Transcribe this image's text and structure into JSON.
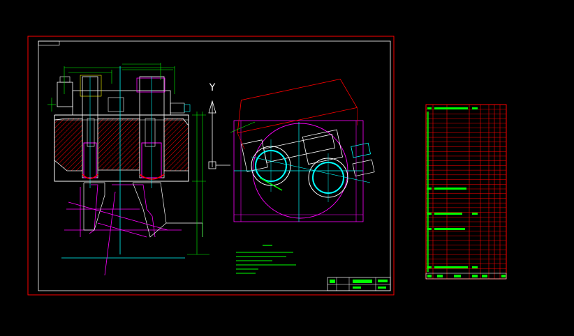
{
  "drawing": {
    "axis_label": "Y",
    "colors": {
      "background": "#000000",
      "frame": "#ff0000",
      "outline": "#ffffff",
      "cyan": "#00ffff",
      "green": "#00ff00",
      "magenta": "#ff00ff",
      "yellow": "#ffff00",
      "red": "#ff0000"
    }
  },
  "bom": {
    "row_count": 36
  }
}
